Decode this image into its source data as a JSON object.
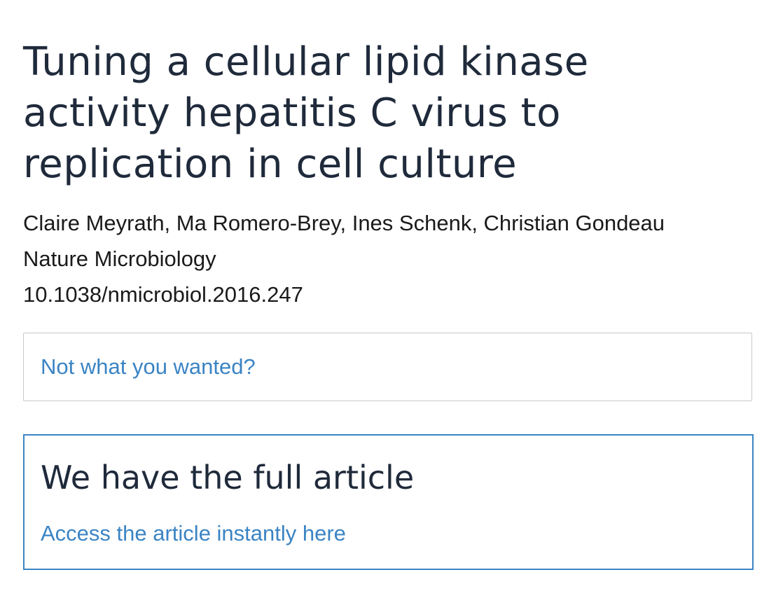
{
  "article": {
    "title": "Tuning a cellular lipid kinase activity hepatitis C virus to replication in cell culture",
    "authors": "Claire Meyrath, Ma Romero-Brey, Ines Schenk, Christian Gondeau",
    "journal": "Nature Microbiology",
    "doi": "10.1038/nmicrobiol.2016.247"
  },
  "not_wanted": {
    "link_label": "Not what you wanted?"
  },
  "full_article": {
    "heading": "We have the full article",
    "link_label": "Access the article instantly here"
  },
  "colors": {
    "title": "#1f2a3b",
    "link": "#3b84c4",
    "box_border": "#c8c8c8",
    "accent_border": "#3b84c4"
  }
}
